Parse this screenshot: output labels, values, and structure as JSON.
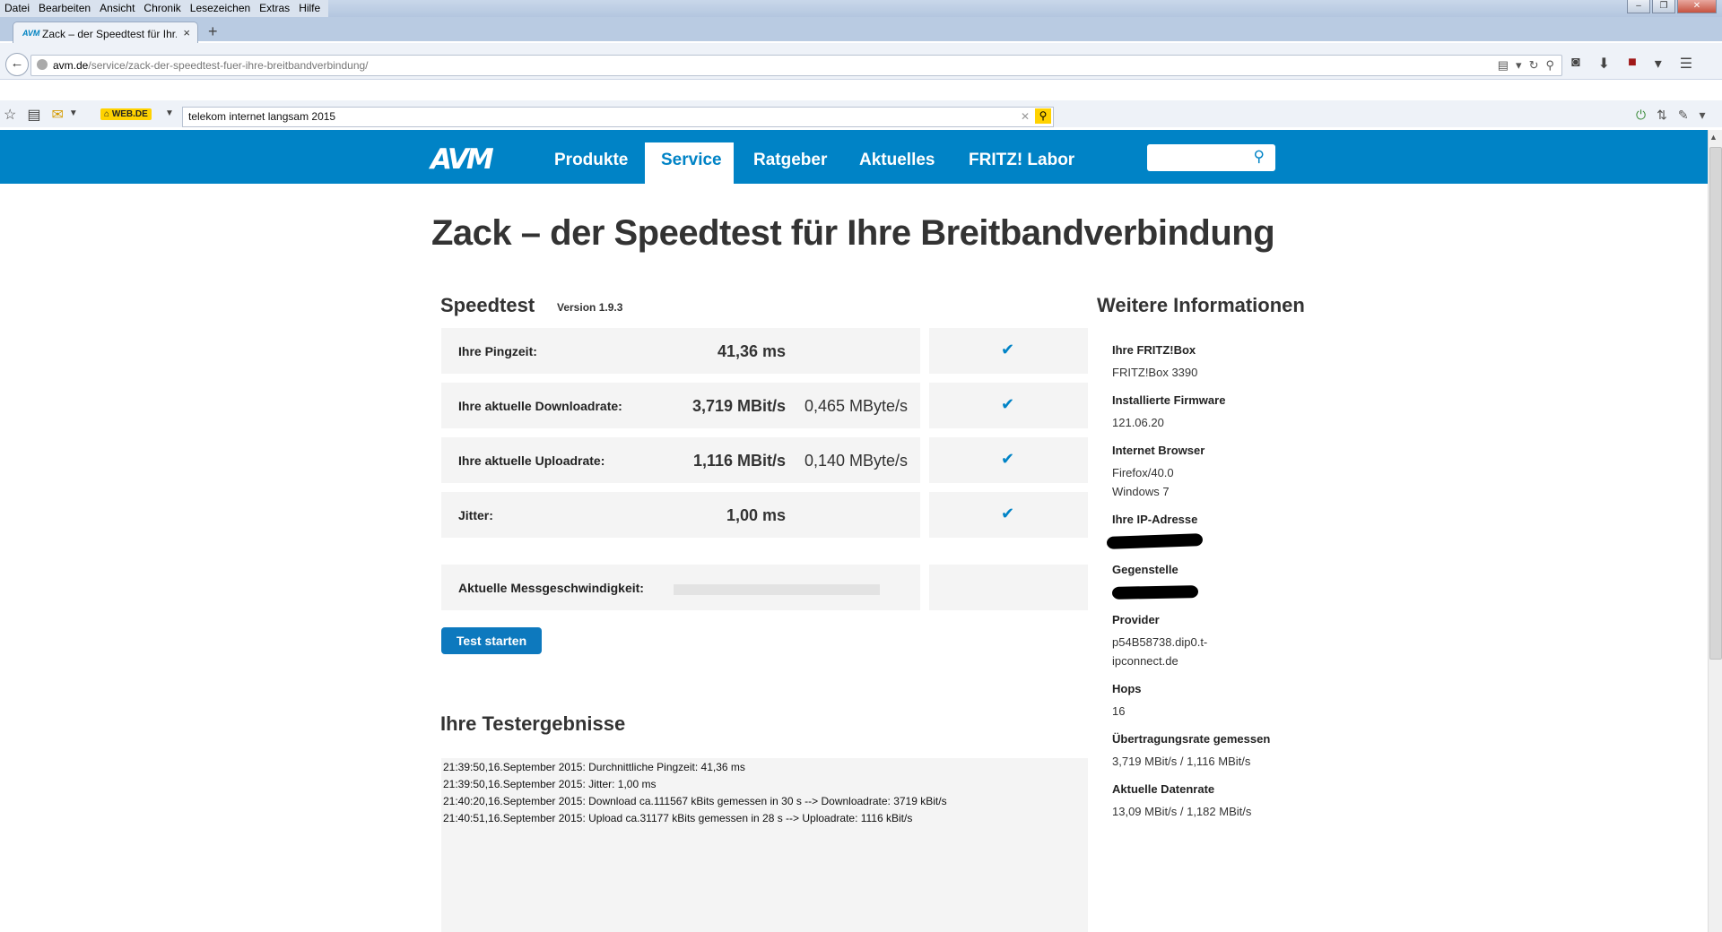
{
  "browser": {
    "menu": [
      "Datei",
      "Bearbeiten",
      "Ansicht",
      "Chronik",
      "Lesezeichen",
      "Extras",
      "Hilfe"
    ],
    "tab_title": "Zack – der Speedtest für Ihr...",
    "tab_favicon": "AVM",
    "url_domain": "avm.de",
    "url_path": "/service/zack-der-speedtest-fuer-ihre-breitbandverbindung/",
    "bookmark_label": "WEB.DE",
    "search_query": "telekom internet langsam 2015"
  },
  "site": {
    "logo": "AVM",
    "nav": [
      "Produkte",
      "Service",
      "Ratgeber",
      "Aktuelles",
      "FRITZ! Labor"
    ],
    "active_nav": "Service",
    "brand_color": "#0083c6"
  },
  "page": {
    "title": "Zack – der Speedtest für Ihre Breitbandverbindung",
    "speedtest_heading": "Speedtest",
    "version": "Version 1.9.3",
    "rows": [
      {
        "label": "Ihre Pingzeit:",
        "value": "41,36 ms",
        "value2": ""
      },
      {
        "label": "Ihre aktuelle Downloadrate:",
        "value": "3,719 MBit/s",
        "value2": "0,465 MByte/s"
      },
      {
        "label": "Ihre aktuelle Uploadrate:",
        "value": "1,116 MBit/s",
        "value2": "0,140 MByte/s"
      },
      {
        "label": "Jitter:",
        "value": "1,00 ms",
        "value2": ""
      }
    ],
    "measure_label": "Aktuelle Messgeschwindigkeit:",
    "start_button": "Test starten",
    "results_heading": "Ihre Testergebnisse",
    "results": [
      "21:39:50,16.September 2015: Durchnittliche Pingzeit: 41,36 ms",
      "21:39:50,16.September 2015: Jitter: 1,00 ms",
      "21:40:20,16.September 2015: Download ca.111567 kBits gemessen in 30 s --> Downloadrate: 3719 kBit/s",
      "21:40:51,16.September 2015: Upload ca.31177 kBits gemessen in 28 s --> Uploadrate: 1116 kBit/s"
    ]
  },
  "info": {
    "heading": "Weitere Informationen",
    "fritzbox_label": "Ihre FRITZ!Box",
    "fritzbox_value": "FRITZ!Box 3390",
    "firmware_label": "Installierte Firmware",
    "firmware_value": "121.06.20",
    "browser_label": "Internet Browser",
    "browser_value1": "Firefox/40.0",
    "browser_value2": "Windows 7",
    "ip_label": "Ihre IP-Adresse",
    "gegenstelle_label": "Gegenstelle",
    "provider_label": "Provider",
    "provider_value1": "p54B58738.dip0.t-",
    "provider_value2": "ipconnect.de",
    "hops_label": "Hops",
    "hops_value": "16",
    "rate_label": "Übertragungsrate gemessen",
    "rate_value": "3,719 MBit/s / 1,116 MBit/s",
    "datarate_label": "Aktuelle Datenrate",
    "datarate_value": "13,09 MBit/s / 1,182 MBit/s"
  }
}
